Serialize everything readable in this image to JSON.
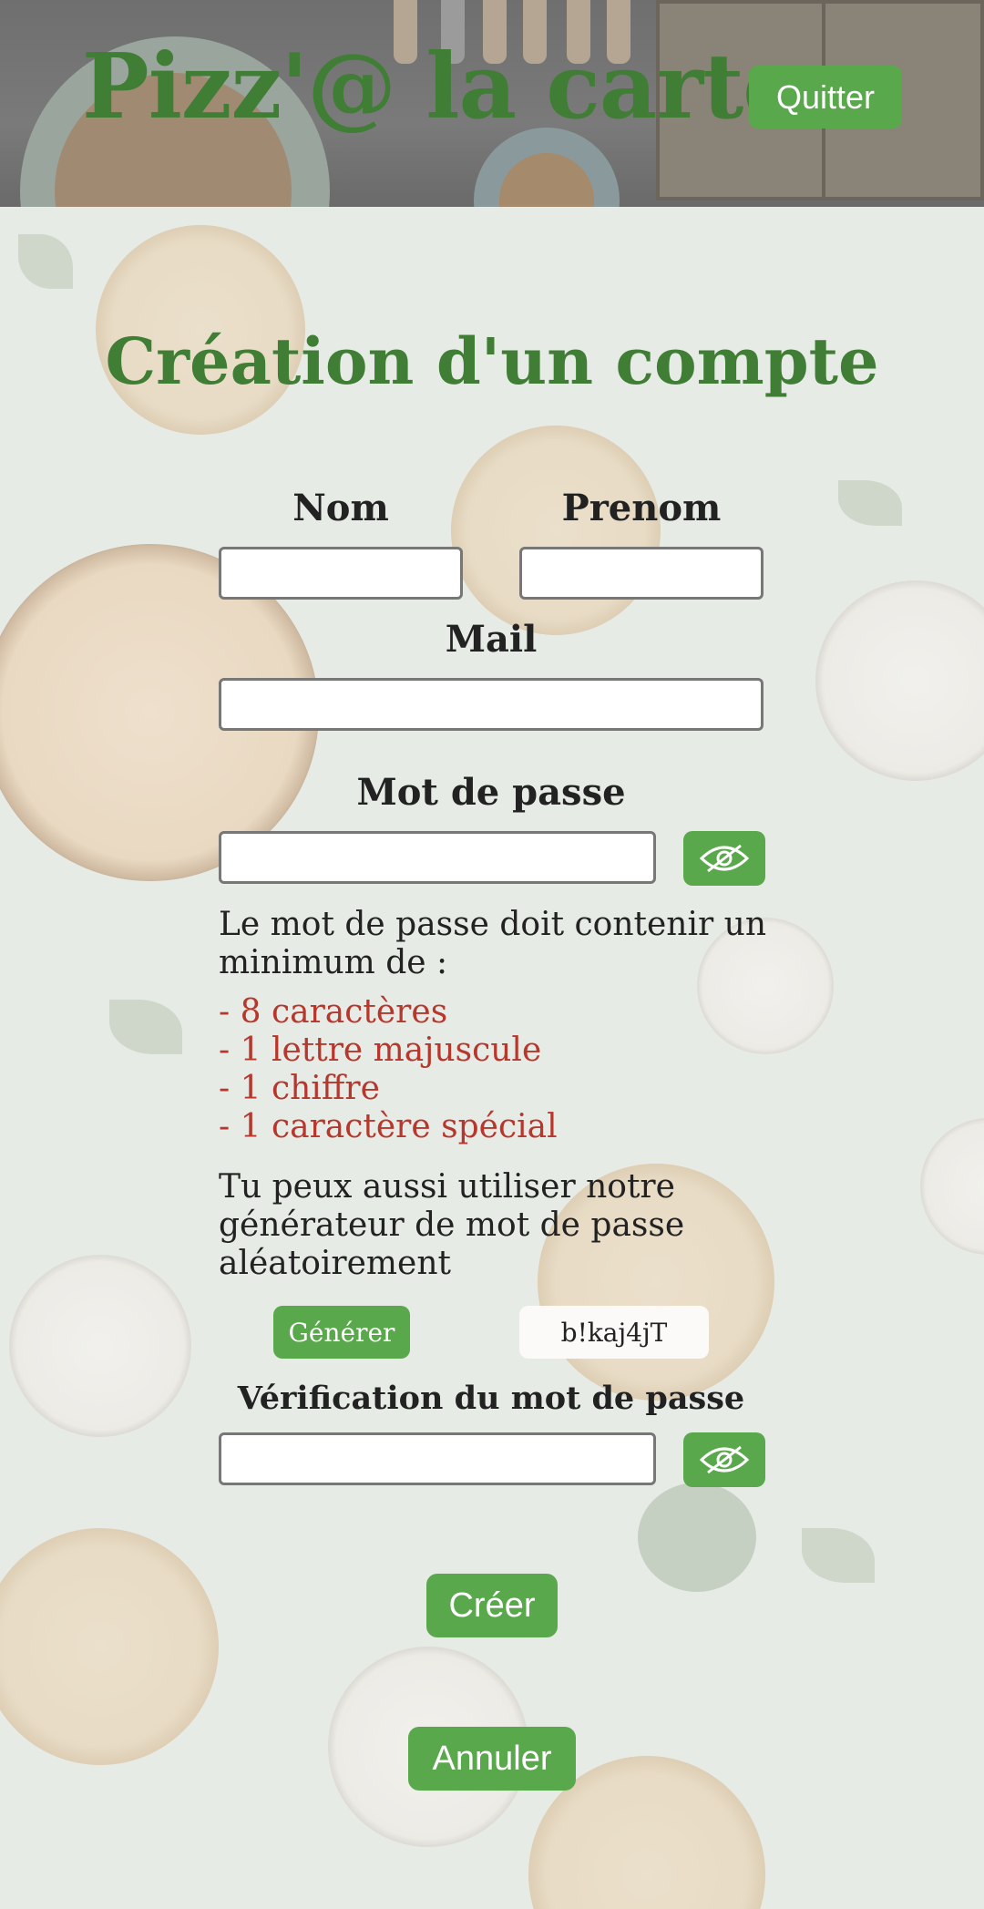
{
  "header": {
    "title": "Pizz'@ la carte",
    "quit_label": "Quitter"
  },
  "page": {
    "title": "Création d'un compte"
  },
  "form": {
    "nom_label": "Nom",
    "nom_value": "",
    "prenom_label": "Prenom",
    "prenom_value": "",
    "mail_label": "Mail",
    "mail_value": "",
    "password_label": "Mot de passe",
    "password_value": "",
    "password_hint_line1": "Le mot de passe doit contenir un",
    "password_hint_line2": "minimum de :",
    "requirements": [
      "- 8 caractères",
      "- 1 lettre majuscule",
      "- 1 chiffre",
      "- 1 caractère spécial"
    ],
    "generator_line1": "Tu peux aussi utiliser notre",
    "generator_line2": "générateur de mot de passe",
    "generator_line3": "aléatoirement",
    "generate_label": "Générer",
    "generated_password": "b!kaj4jT",
    "verify_label": "Vérification du mot de passe",
    "verify_value": "",
    "create_label": "Créer",
    "cancel_label": "Annuler"
  },
  "icons": {
    "toggle_visibility": "eye-slash-icon"
  },
  "colors": {
    "accent_green": "#5aa84c",
    "title_green": "#3f7e34",
    "requirement_red": "#b7372c",
    "background": "#e7ebe6"
  }
}
